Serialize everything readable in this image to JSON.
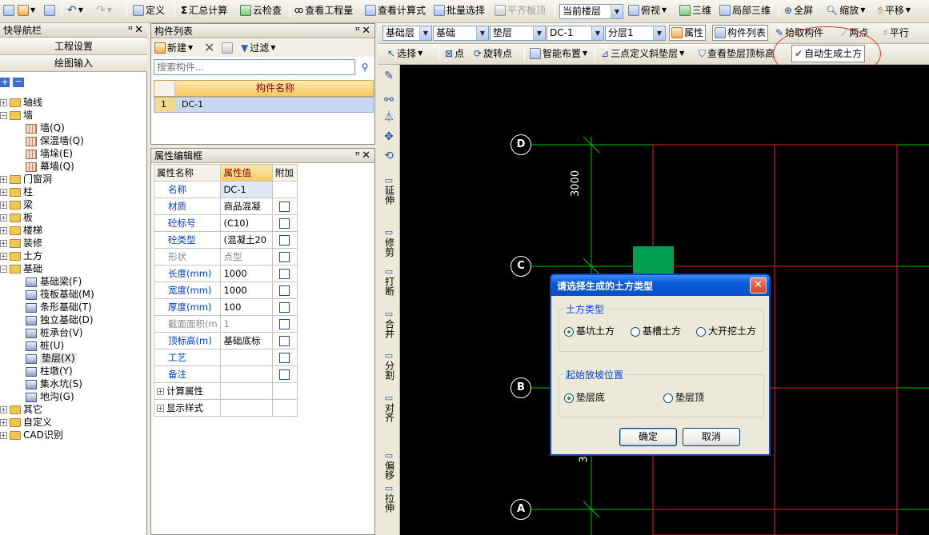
{
  "toolbar1": {
    "define": "定义",
    "sum": "汇总计算",
    "cloud_check": "云检查",
    "view_qty": "查看工程量",
    "view_formula": "查看计算式",
    "batch_select": "批量选择",
    "level_slab": "平齐板顶",
    "floor_select": "当前楼层",
    "top_view": "俯视",
    "three_d": "三维",
    "local_3d": "局部三维",
    "full_screen": "全屏",
    "zoom": "缩放",
    "pan": "平移"
  },
  "nav": {
    "title": "快导航栏",
    "project_settings": "工程设置",
    "draw_input": "绘图输入",
    "tree": [
      {
        "label": "轴线",
        "type": "folder",
        "expanded": false
      },
      {
        "label": "墙",
        "type": "folder",
        "expanded": true
      },
      {
        "label": "墙(Q)",
        "type": "leaf"
      },
      {
        "label": "保温墙(Q)",
        "type": "leaf"
      },
      {
        "label": "墙垛(E)",
        "type": "leaf"
      },
      {
        "label": "幕墙(Q)",
        "type": "leaf"
      },
      {
        "label": "门窗洞",
        "type": "folder",
        "expanded": false
      },
      {
        "label": "柱",
        "type": "folder",
        "expanded": false
      },
      {
        "label": "梁",
        "type": "folder",
        "expanded": false
      },
      {
        "label": "板",
        "type": "folder",
        "expanded": false
      },
      {
        "label": "楼梯",
        "type": "folder",
        "expanded": false
      },
      {
        "label": "装修",
        "type": "folder",
        "expanded": false
      },
      {
        "label": "土方",
        "type": "folder",
        "expanded": false
      },
      {
        "label": "基础",
        "type": "folder",
        "expanded": true
      },
      {
        "label": "基础梁(F)",
        "type": "leaf"
      },
      {
        "label": "筏板基础(M)",
        "type": "leaf"
      },
      {
        "label": "条形基础(T)",
        "type": "leaf"
      },
      {
        "label": "独立基础(D)",
        "type": "leaf"
      },
      {
        "label": "桩承台(V)",
        "type": "leaf"
      },
      {
        "label": "桩(U)",
        "type": "leaf"
      },
      {
        "label": "垫层(X)",
        "type": "leaf",
        "selected": true
      },
      {
        "label": "柱墩(Y)",
        "type": "leaf"
      },
      {
        "label": "集水坑(S)",
        "type": "leaf"
      },
      {
        "label": "地沟(G)",
        "type": "leaf"
      },
      {
        "label": "其它",
        "type": "folder",
        "expanded": false
      },
      {
        "label": "自定义",
        "type": "folder",
        "expanded": false
      },
      {
        "label": "CAD识别",
        "type": "folder",
        "expanded": false
      }
    ]
  },
  "component_list": {
    "title": "构件列表",
    "new_label": "新建",
    "filter_label": "过滤",
    "search_placeholder": "搜索构件...",
    "column_header": "构件名称",
    "rows": [
      {
        "index": "1",
        "name": "DC-1"
      }
    ]
  },
  "property_editor": {
    "title": "属性编辑框",
    "headers": {
      "name": "属性名称",
      "value": "属性值",
      "extra": "附加"
    },
    "rows": [
      {
        "name": "名称",
        "value": "DC-1",
        "checkbox": false
      },
      {
        "name": "材质",
        "value": "商品混凝",
        "checkbox": true
      },
      {
        "name": "砼标号",
        "value": "(C10)",
        "checkbox": true
      },
      {
        "name": "砼类型",
        "value": "(混凝土20",
        "checkbox": true
      },
      {
        "name": "形状",
        "value": "点型",
        "checkbox": true,
        "gray": true
      },
      {
        "name": "长度(mm)",
        "value": "1000",
        "checkbox": true
      },
      {
        "name": "宽度(mm)",
        "value": "1000",
        "checkbox": true
      },
      {
        "name": "厚度(mm)",
        "value": "100",
        "checkbox": true
      },
      {
        "name": "截面面积(m",
        "value": "1",
        "checkbox": true,
        "gray": true
      },
      {
        "name": "顶标高(m)",
        "value": "基础底标",
        "checkbox": true
      },
      {
        "name": "工艺",
        "value": "",
        "checkbox": true
      },
      {
        "name": "备注",
        "value": "",
        "checkbox": true
      }
    ],
    "groups": [
      "计算属性",
      "显示样式"
    ]
  },
  "canvas_toolbar1": {
    "layer_group": "基础层",
    "category": "基础",
    "type": "垫层",
    "component": "DC-1",
    "sublayer": "分层1",
    "property_btn": "属性",
    "component_list_btn": "构件列表",
    "pick_component": "拾取构件",
    "two_points": "两点",
    "parallel": "平行"
  },
  "canvas_toolbar2": {
    "select": "选择",
    "point": "点",
    "rotate_point": "旋转点",
    "smart_layout": "智能布置",
    "three_point_slope": "三点定义斜垫层",
    "view_top_elev": "查看垫层顶标高",
    "auto_earthwork": "自动生成土方"
  },
  "vertical_tools": [
    "延伸",
    "修剪",
    "打断",
    "合并",
    "分割",
    "对齐",
    "偏移",
    "拉伸"
  ],
  "canvas": {
    "axes": [
      "D",
      "C",
      "B",
      "A"
    ],
    "dimension": "3000",
    "dimension2": "3"
  },
  "dialog": {
    "title": "请选择生成的土方类型",
    "group1_title": "土方类型",
    "options1": [
      "基坑土方",
      "基槽土方",
      "大开挖土方"
    ],
    "selected1": 0,
    "group2_title": "起始放坡位置",
    "options2": [
      "垫层底",
      "垫层顶"
    ],
    "selected2": 0,
    "ok": "确定",
    "cancel": "取消"
  },
  "colors": {
    "canvas_bg": "#000000",
    "axis_line": "#00c000",
    "grid_red": "#e02020",
    "dialog_title": "#0a5ad6",
    "highlight": "#fbe6a4"
  }
}
